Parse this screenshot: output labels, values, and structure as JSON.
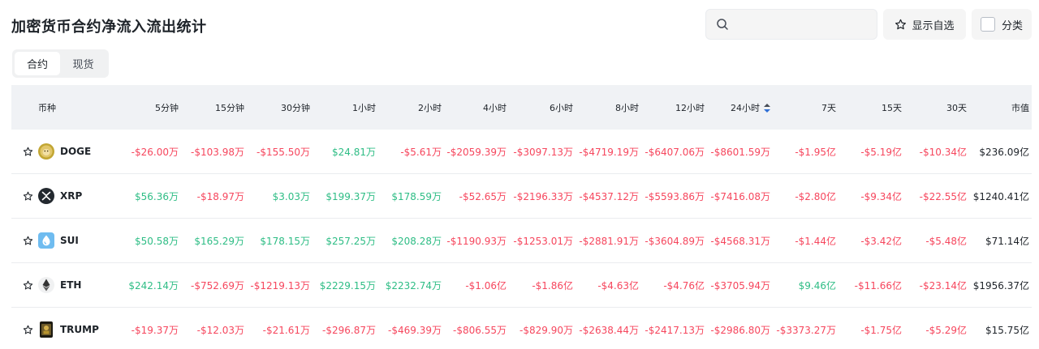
{
  "title": "加密货币合约净流入流出统计",
  "search": {
    "placeholder": "",
    "value": ""
  },
  "favorites_label": "显示自选",
  "category_label": "分类",
  "tabs": [
    {
      "label": "合约",
      "active": true
    },
    {
      "label": "现货",
      "active": false
    }
  ],
  "columns": [
    "币种",
    "5分钟",
    "15分钟",
    "30分钟",
    "1小时",
    "2小时",
    "4小时",
    "6小时",
    "8小时",
    "12小时",
    "24小时",
    "7天",
    "15天",
    "30天",
    "市值"
  ],
  "sorted_column": "24小时",
  "colors": {
    "positive": "#2ebd85",
    "negative": "#f6465d"
  },
  "rows": [
    {
      "symbol": "DOGE",
      "icon": "doge-logo-icon",
      "values": [
        "-$26.00万",
        "-$103.98万",
        "-$155.50万",
        "$24.81万",
        "-$5.61万",
        "-$2059.39万",
        "-$3097.13万",
        "-$4719.19万",
        "-$6407.06万",
        "-$8601.59万",
        "-$1.95亿",
        "-$5.19亿",
        "-$10.34亿"
      ],
      "market_cap": "$236.09亿"
    },
    {
      "symbol": "XRP",
      "icon": "xrp-logo-icon",
      "values": [
        "$56.36万",
        "-$18.97万",
        "$3.03万",
        "$199.37万",
        "$178.59万",
        "-$52.65万",
        "-$2196.33万",
        "-$4537.12万",
        "-$5593.86万",
        "-$7416.08万",
        "-$2.80亿",
        "-$9.34亿",
        "-$22.55亿"
      ],
      "market_cap": "$1240.41亿"
    },
    {
      "symbol": "SUI",
      "icon": "sui-logo-icon",
      "values": [
        "$50.58万",
        "$165.29万",
        "$178.15万",
        "$257.25万",
        "$208.28万",
        "-$1190.93万",
        "-$1253.01万",
        "-$2881.91万",
        "-$3604.89万",
        "-$4568.31万",
        "-$1.44亿",
        "-$3.42亿",
        "-$5.48亿"
      ],
      "market_cap": "$71.14亿"
    },
    {
      "symbol": "ETH",
      "icon": "eth-logo-icon",
      "values": [
        "$242.14万",
        "-$752.69万",
        "-$1219.13万",
        "$2229.15万",
        "$2232.74万",
        "-$1.06亿",
        "-$1.86亿",
        "-$4.63亿",
        "-$4.76亿",
        "-$3705.94万",
        "$9.46亿",
        "-$11.66亿",
        "-$23.14亿"
      ],
      "market_cap": "$1956.37亿"
    },
    {
      "symbol": "TRUMP",
      "icon": "trump-logo-icon",
      "values": [
        "-$19.37万",
        "-$12.03万",
        "-$21.61万",
        "-$296.87万",
        "-$469.39万",
        "-$806.55万",
        "-$829.90万",
        "-$2638.44万",
        "-$2417.13万",
        "-$2986.80万",
        "-$3373.27万",
        "-$1.75亿",
        "-$5.29亿"
      ],
      "market_cap": "$15.75亿"
    }
  ]
}
